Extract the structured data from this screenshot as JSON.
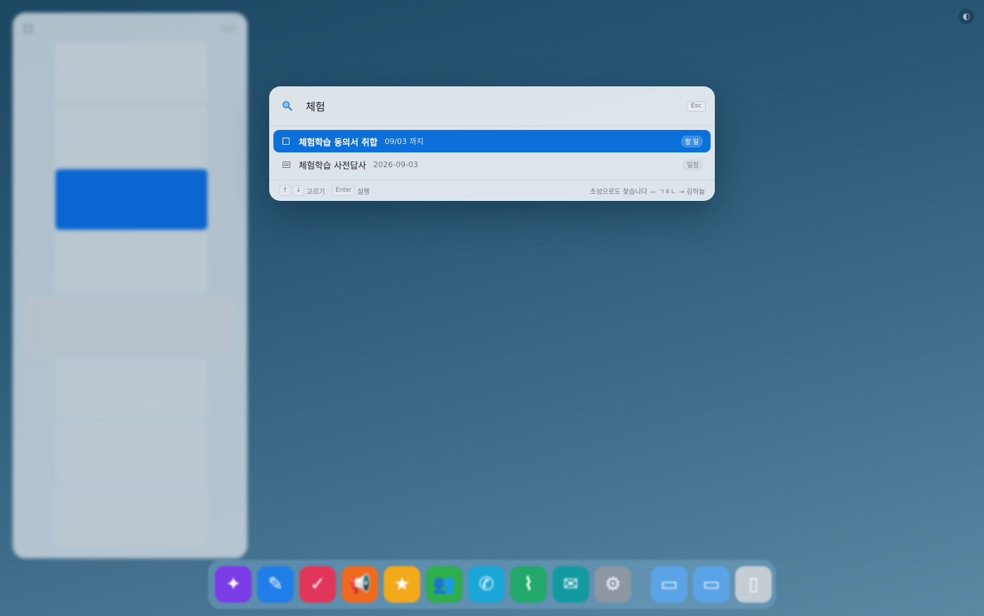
{
  "search": {
    "query": "체험",
    "placeholder": "",
    "esc_label": "Esc"
  },
  "results": [
    {
      "title": "체험학습 동의서 취합",
      "meta": "09/03 까지",
      "badge": "할 일",
      "icon": "checkbox-icon",
      "selected": true
    },
    {
      "title": "체험학습 사전답사",
      "meta": "2026-09-03",
      "badge": "일정",
      "icon": "list-icon",
      "selected": false
    }
  ],
  "footer": {
    "up_key": "↑",
    "down_key": "↓",
    "nav_label": "고르기",
    "enter_key": "Enter",
    "enter_label": "실행",
    "hint": "초성으로도 찾습니다 — ㄱㅎㄴ → 김하늘"
  },
  "theme_toggle": {
    "icon": "half-circle-icon",
    "glyph": "◐"
  },
  "dock": {
    "apps": [
      {
        "name": "dock-app-sparkle",
        "glyph": "✦",
        "color": "#7a3de8"
      },
      {
        "name": "dock-app-pen",
        "glyph": "✎",
        "color": "#1f7ee8"
      },
      {
        "name": "dock-app-checklist",
        "glyph": "✓",
        "color": "#e2355a"
      },
      {
        "name": "dock-app-megaphone",
        "glyph": "📢",
        "color": "#ee6a1f"
      },
      {
        "name": "dock-app-star",
        "glyph": "★",
        "color": "#f2a91a"
      },
      {
        "name": "dock-app-people",
        "glyph": "👥",
        "color": "#2fae4c"
      },
      {
        "name": "dock-app-phone",
        "glyph": "✆",
        "color": "#1aa7d8"
      },
      {
        "name": "dock-app-broom",
        "glyph": "⌇",
        "color": "#22a86a"
      },
      {
        "name": "dock-app-chat",
        "glyph": "✉",
        "color": "#139aa0"
      },
      {
        "name": "dock-app-settings",
        "glyph": "⚙",
        "color": "#8d97a2"
      },
      {
        "name": "dock-app-folder-1",
        "glyph": "▭",
        "color": "#5aa3e6"
      },
      {
        "name": "dock-app-folder-2",
        "glyph": "▭",
        "color": "#5aa3e6"
      },
      {
        "name": "dock-app-trash",
        "glyph": "▯",
        "color": "#c4ccd4"
      }
    ]
  }
}
